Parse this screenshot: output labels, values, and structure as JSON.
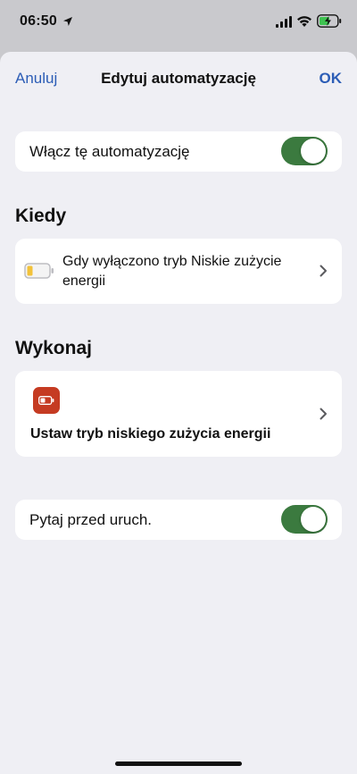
{
  "status_bar": {
    "time": "06:50"
  },
  "nav": {
    "cancel_label": "Anuluj",
    "title": "Edytuj automatyzację",
    "ok_label": "OK"
  },
  "enable_row": {
    "label": "Włącz tę automatyzację",
    "enabled": true
  },
  "when_section": {
    "header": "Kiedy",
    "trigger_label": "Gdy wyłączono tryb Niskie zużycie energii",
    "icon": "battery-low-icon"
  },
  "do_section": {
    "header": "Wykonaj",
    "action_label": "Ustaw tryb niskiego zużycia energii",
    "icon": "low-power-mode-icon"
  },
  "ask_row": {
    "label": "Pytaj przed uruch.",
    "enabled": true
  },
  "colors": {
    "accent": "#2c5db6",
    "toggle_on": "#3b7a3f",
    "action_icon_bg": "#c53b22",
    "battery_level": "#f2c23a"
  }
}
